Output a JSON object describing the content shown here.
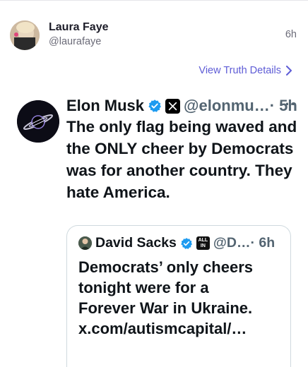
{
  "post": {
    "author_name": "Laura Faye",
    "author_handle": "@laurafaye",
    "time": "6h",
    "details_link": "View Truth Details"
  },
  "quoted": {
    "name": "Elon Musk",
    "handle": "@elonmu…",
    "time": "· 5h",
    "more": "···",
    "text": "The only flag being waved and the ONLY cheer by Democrats was for another country. They hate America.",
    "inner": {
      "name": "David Sacks",
      "handle": "@D…",
      "time": "· 6h",
      "badge_top": "ALL",
      "badge_bottom": "IN",
      "text_line1": "Democrats’ only cheers",
      "text_line2": "tonight were for a",
      "text_line3": "Forever War in Ukraine.",
      "text_line4": "x.com/autismcapital/…"
    }
  },
  "colors": {
    "link": "#5e5cd6",
    "verified": "#1d9bf0",
    "muted": "#536471"
  }
}
